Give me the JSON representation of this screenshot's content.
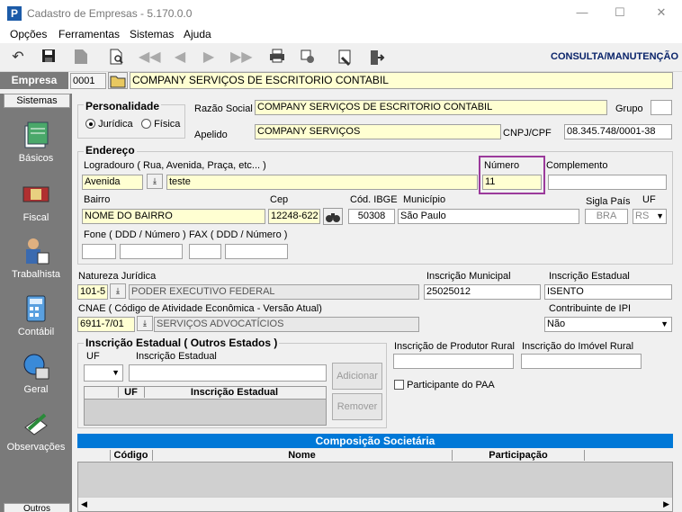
{
  "window": {
    "title": "Cadastro de Empresas - 5.170.0.0",
    "app_letter": "P",
    "minimize": "—",
    "maximize": "☐",
    "close": "✕"
  },
  "menu": {
    "items": [
      "Opções",
      "Ferramentas",
      "Sistemas",
      "Ajuda"
    ]
  },
  "toolbar": {
    "mode": "CONSULTA/MANUTENÇÃO"
  },
  "empresa": {
    "label": "Empresa",
    "code": "0001",
    "name": "COMPANY SERVIÇOS DE ESCRITORIO CONTABIL"
  },
  "sidebar": {
    "tab": "Sistemas",
    "items": [
      "Básicos",
      "Fiscal",
      "Trabalhista",
      "Contábil",
      "Geral",
      "Observações"
    ],
    "bottom_tab": "Outros"
  },
  "personalidade": {
    "title": "Personalidade",
    "options": [
      "Jurídica",
      "Física"
    ],
    "selected": 0
  },
  "razao_social": {
    "label": "Razão Social",
    "value": "COMPANY SERVIÇOS DE ESCRITORIO CONTABIL"
  },
  "grupo": {
    "label": "Grupo",
    "value": ""
  },
  "apelido": {
    "label": "Apelido",
    "value": "COMPANY SERVIÇOS"
  },
  "cnpj": {
    "label": "CNPJ/CPF",
    "value": "08.345.748/0001-38"
  },
  "endereco": {
    "title": "Endereço",
    "logradouro_label": "Logradouro ( Rua, Avenida, Praça, etc... )",
    "tipo": "Avenida",
    "logradouro": "teste",
    "numero_label": "Número",
    "numero": "11",
    "complemento_label": "Complemento",
    "complemento": "",
    "bairro_label": "Bairro",
    "bairro": "NOME DO BAIRRO",
    "cep_label": "Cep",
    "cep": "12248-622",
    "ibge_label": "Cód. IBGE",
    "ibge": "50308",
    "municipio_label": "Município",
    "municipio": "São Paulo",
    "sigla_pais_label": "Sigla País",
    "sigla_pais": "BRA",
    "uf_label": "UF",
    "uf": "RS",
    "fone_label": "Fone ( DDD / Número )",
    "fax_label": "FAX ( DDD / Número )"
  },
  "natureza": {
    "label": "Natureza Jurídica",
    "code": "101-5",
    "desc": "PODER EXECUTIVO FEDERAL"
  },
  "insc_municipal": {
    "label": "Inscrição Municipal",
    "value": "25025012"
  },
  "insc_estadual": {
    "label": "Inscrição Estadual",
    "value": "ISENTO"
  },
  "cnae": {
    "label": "CNAE ( Código de Atividade Econômica - Versão Atual)",
    "code": "6911-7/01",
    "desc": "SERVIÇOS ADVOCATÍCIOS"
  },
  "contrib_ipi": {
    "label": "Contribuinte de IPI",
    "value": "Não"
  },
  "ie_outros": {
    "title": "Inscrição Estadual ( Outros Estados )",
    "uf_label": "UF",
    "ie_label": "Inscrição Estadual",
    "add": "Adicionar",
    "remove": "Remover",
    "col_uf": "UF",
    "col_ie": "Inscrição Estadual"
  },
  "produtor_rural": {
    "label": "Inscrição de Produtor Rural",
    "value": ""
  },
  "imovel_rural": {
    "label": "Inscrição do Imóvel Rural",
    "value": ""
  },
  "paa": {
    "label": "Participante do PAA"
  },
  "composicao": {
    "title": "Composição Societária",
    "cols": [
      "Código",
      "Nome",
      "Participação"
    ]
  },
  "colors": {
    "accent": "#0078d7",
    "highlight": "#9b3a9b",
    "sidebar": "#7a7a7a",
    "required": "#ffffd2"
  }
}
